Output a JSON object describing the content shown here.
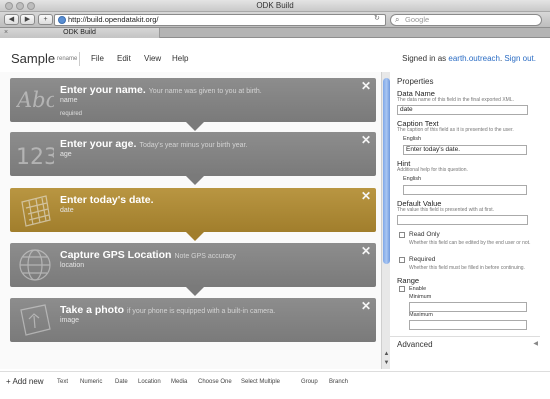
{
  "window": {
    "title": "ODK Build"
  },
  "browser": {
    "back": "◀",
    "forward": "▶",
    "add_tab": "+",
    "url": "http://build.opendatakit.org/",
    "reload": "↻",
    "search_placeholder": "Google",
    "tab_label": "ODK Build"
  },
  "header": {
    "form_title": "Sample",
    "rename_label": "rename",
    "menu": [
      "File",
      "Edit",
      "View",
      "Help"
    ],
    "signed_in_prefix": "Signed in as",
    "user": "earth.outreach",
    "sign_out": "Sign out."
  },
  "questions": [
    {
      "title": "Enter your name.",
      "hint": "Your name was given to you at birth.",
      "name": "name",
      "required": "required",
      "icon": "text-abc-icon",
      "selected": false
    },
    {
      "title": "Enter your age.",
      "hint": "Today's year minus your birth year.",
      "name": "age",
      "required": "",
      "icon": "numeric-123-icon",
      "selected": false
    },
    {
      "title": "Enter today's date.",
      "hint": "",
      "name": "date",
      "required": "",
      "icon": "calendar-icon",
      "selected": true
    },
    {
      "title": "Capture GPS Location",
      "hint": "Note GPS accuracy",
      "name": "location",
      "required": "",
      "icon": "globe-icon",
      "selected": false
    },
    {
      "title": "Take a photo",
      "hint": "if your phone is equipped with a built-in camera.",
      "name": "image",
      "required": "",
      "icon": "image-icon",
      "selected": false
    }
  ],
  "delete_glyph": "✕",
  "properties": {
    "title": "Properties",
    "data_name": {
      "label": "Data Name",
      "desc": "The data name of this field in the final exported XML.",
      "value": "date"
    },
    "caption": {
      "label": "Caption Text",
      "desc": "The caption of this field as it is presented to the user.",
      "lang": "English",
      "value": "Enter today's date."
    },
    "hint": {
      "label": "Hint",
      "desc": "Additional help for this question.",
      "lang": "English",
      "value": ""
    },
    "default": {
      "label": "Default Value",
      "desc": "The value this field is presented with at first.",
      "value": ""
    },
    "read_only": {
      "label": "Read Only",
      "desc": "Whether this field can be edited by the end user or not.",
      "checked": false
    },
    "required": {
      "label": "Required",
      "desc": "Whether this field must be filled in before continuing.",
      "checked": false
    },
    "range": {
      "label": "Range",
      "enable": "Enable",
      "minimum": "Minimum",
      "maximum": "Maximum"
    },
    "advanced": "Advanced"
  },
  "bottombar": {
    "add_new": "Add new",
    "controls": [
      "Text",
      "Numeric",
      "Date",
      "Location",
      "Media",
      "Choose One",
      "Select Multiple",
      "Group",
      "Branch"
    ]
  },
  "colors": {
    "card": "#7f7f7f",
    "card_selected": "#a8852f",
    "link": "#2a6cc4",
    "scroll_thumb": "#8fb3ec"
  }
}
